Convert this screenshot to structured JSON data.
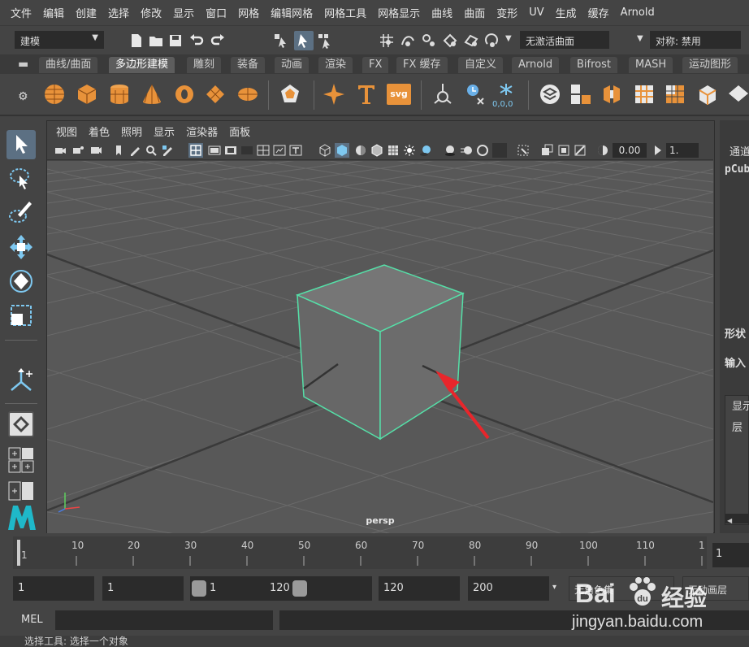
{
  "menubar": {
    "items": [
      "文件",
      "编辑",
      "创建",
      "选择",
      "修改",
      "显示",
      "窗口",
      "网格",
      "编辑网格",
      "网格工具",
      "网格显示",
      "曲线",
      "曲面",
      "变形",
      "UV",
      "生成",
      "缓存",
      "Arnold"
    ]
  },
  "statusline": {
    "mode": "建模",
    "live_surface": "无激活曲面",
    "symmetry": "对称: 禁用"
  },
  "shelf": {
    "tabs": [
      "曲线/曲面",
      "多边形建模",
      "雕刻",
      "装备",
      "动画",
      "渲染",
      "FX",
      "FX 缓存",
      "自定义",
      "Arnold",
      "Bifrost",
      "MASH",
      "运动图形"
    ],
    "active_tab": "多边形建模",
    "svg_label": "svg",
    "coords_label": "0,0,0"
  },
  "viewport": {
    "menu": [
      "视图",
      "着色",
      "照明",
      "显示",
      "渲染器",
      "面板"
    ],
    "camera": "persp",
    "exposure_value": "0.00",
    "gamma_value": "1."
  },
  "channelbox": {
    "channels_label": "通道",
    "object_name": "pCub",
    "shapes_label": "形状",
    "inputs_label": "输入",
    "display_tab": "显示",
    "layers_label": "层"
  },
  "timeslider": {
    "ticks": [
      "1",
      "10",
      "20",
      "30",
      "40",
      "50",
      "60",
      "70",
      "80",
      "90",
      "100",
      "110",
      "1"
    ],
    "current_frame": "1"
  },
  "rangebar": {
    "start_frame": "1",
    "playback_start": "1",
    "range_left": "1",
    "range_right": "120",
    "playback_end": "120",
    "end_frame": "200",
    "character_set": "无角色集",
    "anim_layer": "无动画层"
  },
  "cmdline": {
    "lang_label": "MEL",
    "help_text": "选择工具: 选择一个对象"
  },
  "watermark": {
    "brand_text": "Bai",
    "brand_text2": "经验",
    "url_text": "jingyan.baidu.com"
  },
  "colors": {
    "accent": "#5c7083",
    "cube_wire": "#55e0a8",
    "arrow": "#e8262b",
    "viewport_bg": "#575757"
  }
}
